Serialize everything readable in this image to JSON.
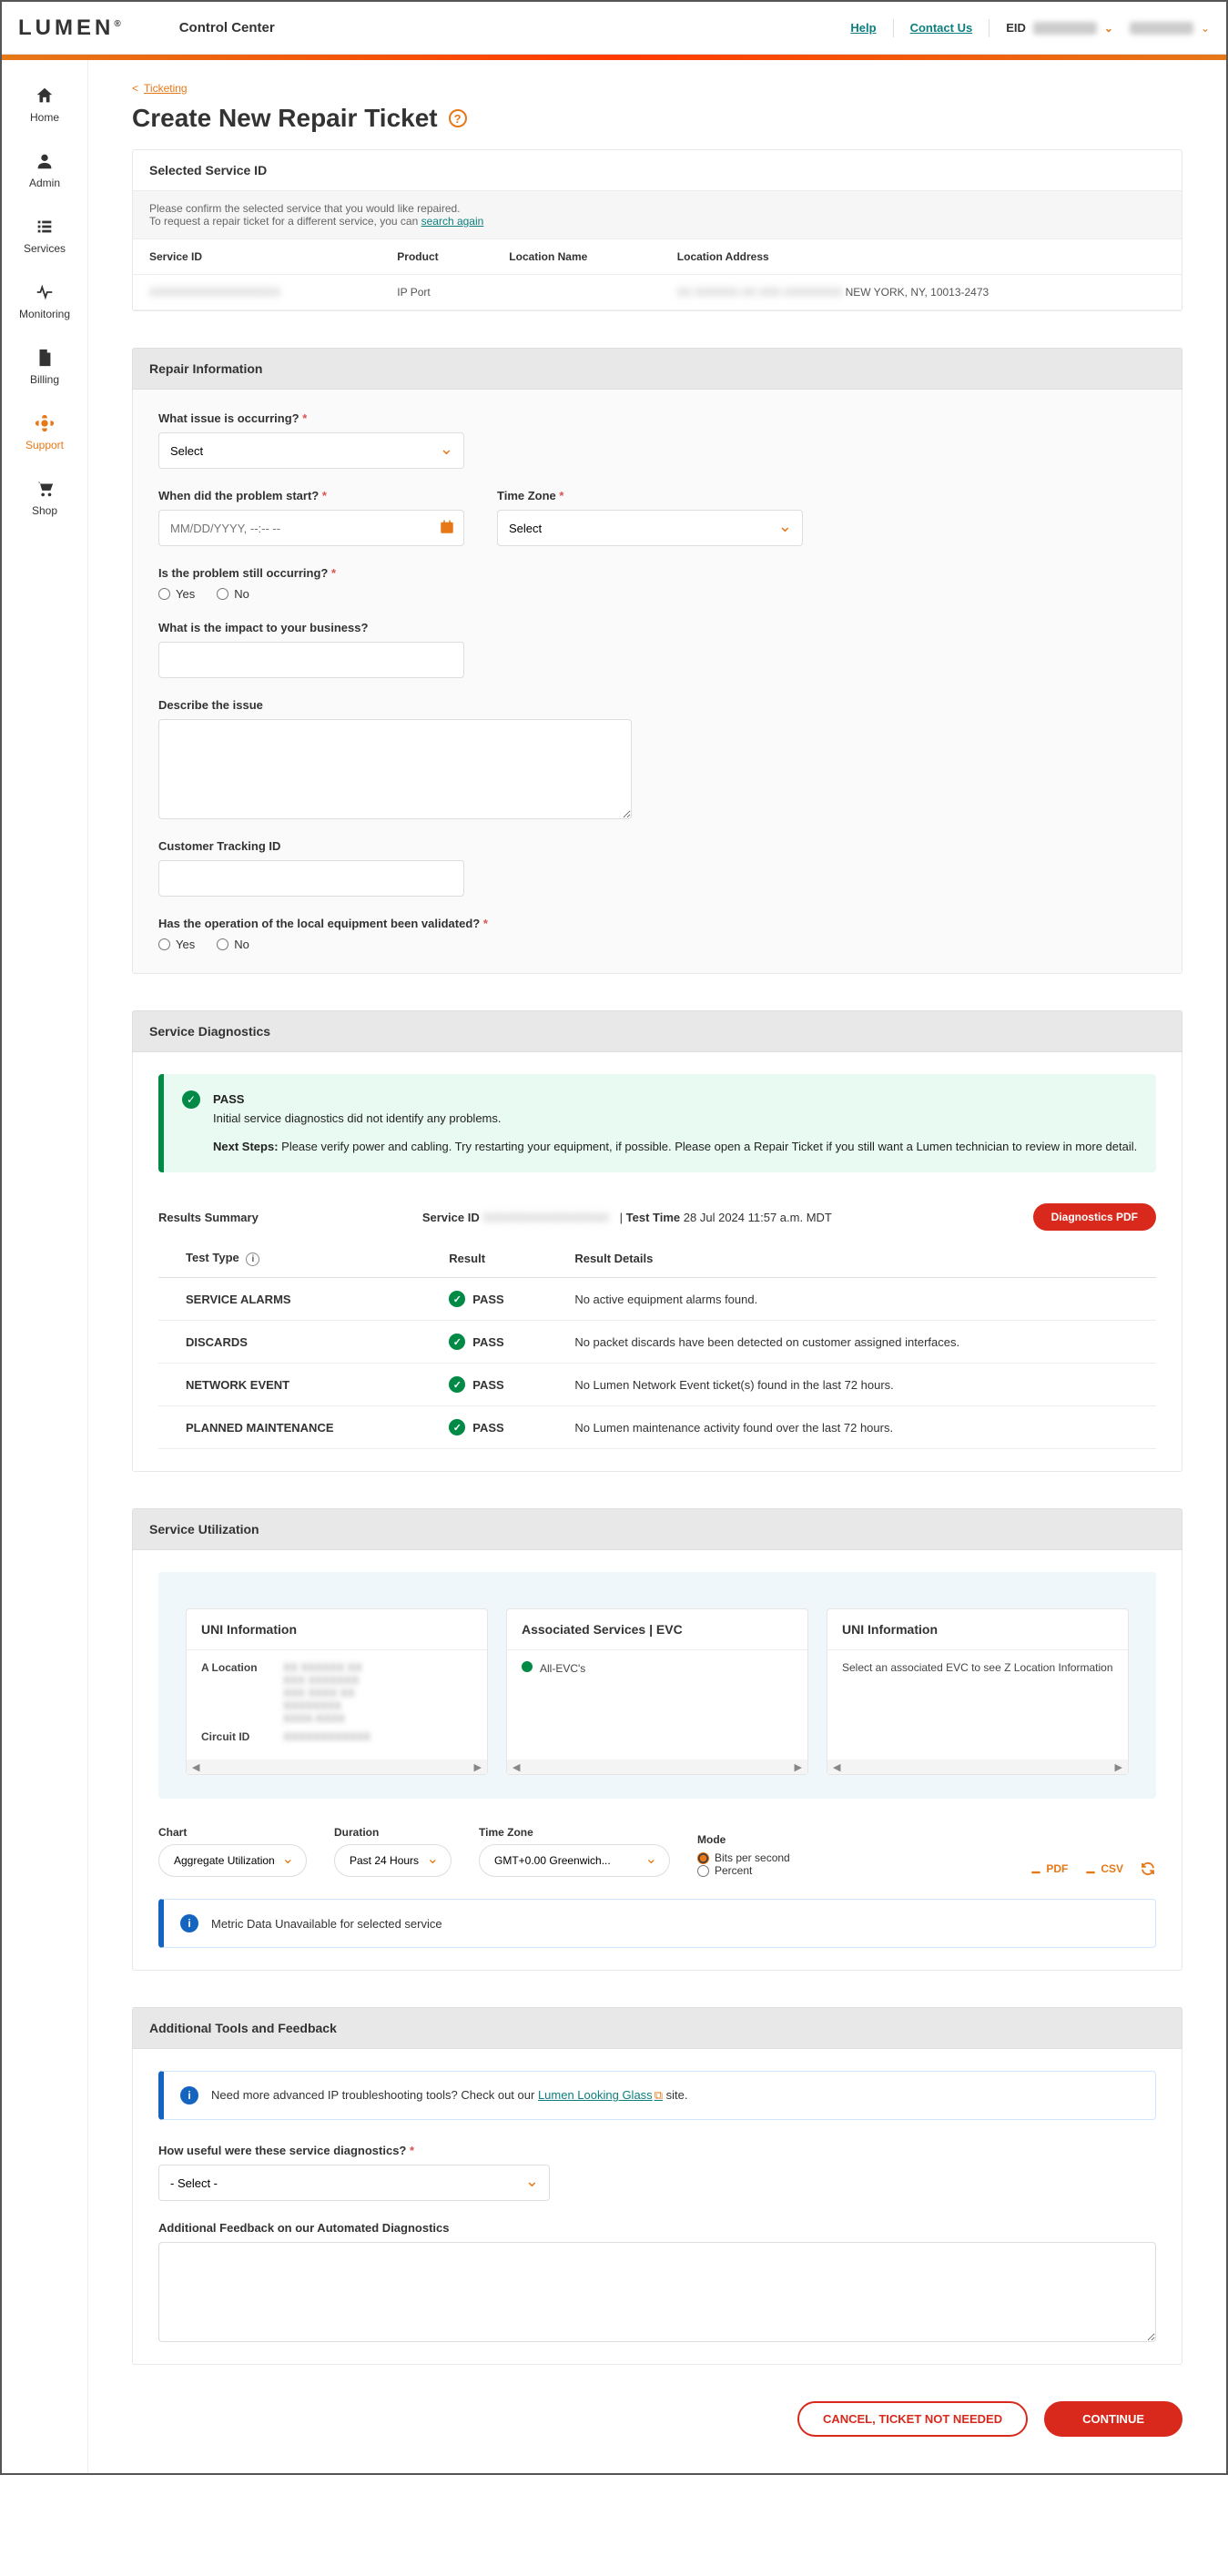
{
  "header": {
    "logo": "LUMEN",
    "app_title": "Control Center",
    "help": "Help",
    "contact": "Contact Us",
    "eid_label": "EID"
  },
  "sidebar": {
    "items": [
      {
        "label": "Home"
      },
      {
        "label": "Admin"
      },
      {
        "label": "Services"
      },
      {
        "label": "Monitoring"
      },
      {
        "label": "Billing"
      },
      {
        "label": "Support"
      },
      {
        "label": "Shop"
      }
    ]
  },
  "breadcrumb": {
    "back": "Ticketing"
  },
  "page_title": "Create New Repair Ticket",
  "selected_service": {
    "head": "Selected Service ID",
    "note1": "Please confirm the selected service that you would like repaired.",
    "note2_a": "To request a repair ticket for a different service, you can ",
    "note2_link": "search again",
    "cols": {
      "id": "Service ID",
      "product": "Product",
      "locname": "Location Name",
      "locaddr": "Location Address"
    },
    "row": {
      "product": "IP Port",
      "addr_tail": "NEW YORK, NY, 10013-2473"
    }
  },
  "repair": {
    "head": "Repair Information",
    "issue_label": "What issue is occurring?",
    "issue_select": "Select",
    "when_label": "When did the problem start?",
    "when_ph": "MM/DD/YYYY, --:-- --",
    "tz_label": "Time Zone",
    "tz_select": "Select",
    "still_label": "Is the problem still occurring?",
    "yes": "Yes",
    "no": "No",
    "impact_label": "What is the impact to your business?",
    "describe_label": "Describe the issue",
    "tracking_label": "Customer Tracking ID",
    "validated_label": "Has the operation of the local equipment been validated?"
  },
  "diag": {
    "head": "Service Diagnostics",
    "pass": "PASS",
    "pass_msg": "Initial service diagnostics did not identify any problems.",
    "next_label": "Next Steps:",
    "next_msg": " Please verify power and cabling. Try restarting your equipment, if possible. Please open a Repair Ticket if you still want a Lumen technician to review in more detail.",
    "results_summary": "Results Summary",
    "service_id_lbl": "Service ID",
    "test_time_lbl": "Test Time",
    "test_time": "28 Jul 2024 11:57 a.m. MDT",
    "pdf_btn": "Diagnostics PDF",
    "cols": {
      "type": "Test Type",
      "result": "Result",
      "details": "Result Details"
    },
    "rows": [
      {
        "type": "SERVICE ALARMS",
        "details": "No active equipment alarms found."
      },
      {
        "type": "DISCARDS",
        "details": "No packet discards have been detected on customer assigned interfaces."
      },
      {
        "type": "NETWORK EVENT",
        "details": "No Lumen Network Event ticket(s) found in the last 72 hours."
      },
      {
        "type": "PLANNED MAINTENANCE",
        "details": "No Lumen maintenance activity found over the last 72 hours."
      }
    ]
  },
  "util": {
    "head": "Service Utilization",
    "card1": {
      "title": "UNI Information",
      "aloc": "A Location",
      "circuit": "Circuit ID"
    },
    "card2": {
      "title": "Associated Services | EVC",
      "evc": "All-EVC's"
    },
    "card3": {
      "title": "UNI Information",
      "msg": "Select an associated EVC to see Z Location Information"
    },
    "chart_lbl": "Chart",
    "chart_val": "Aggregate Utilization",
    "duration_lbl": "Duration",
    "duration_val": "Past 24 Hours",
    "tz_lbl": "Time Zone",
    "tz_val": "GMT+0.00 Greenwich...",
    "mode_lbl": "Mode",
    "mode_bps": "Bits per second",
    "mode_pct": "Percent",
    "pdf": "PDF",
    "csv": "CSV",
    "unavail": "Metric Data Unavailable for selected service"
  },
  "tools": {
    "head": "Additional Tools and Feedback",
    "banner_a": "Need more advanced IP troubleshooting tools? Check out our ",
    "banner_link": "Lumen Looking Glass",
    "banner_b": " site.",
    "useful_label": "How useful were these service diagnostics?",
    "useful_select": "- Select -",
    "feedback_label": "Additional Feedback on our Automated Diagnostics"
  },
  "footer": {
    "cancel": "CANCEL, TICKET NOT NEEDED",
    "continue": "CONTINUE"
  }
}
